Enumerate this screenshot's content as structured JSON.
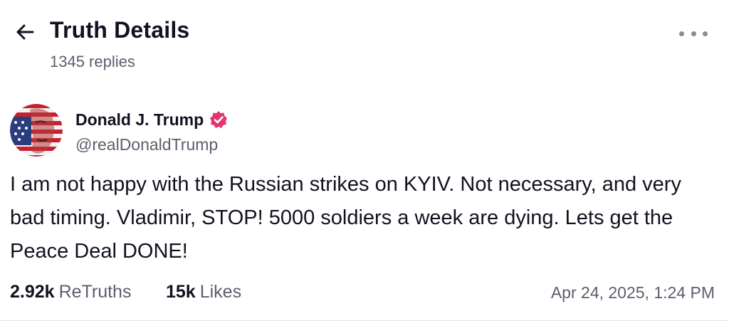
{
  "header": {
    "back_icon": "arrow-left-icon",
    "title": "Truth Details",
    "replies": "1345 replies",
    "more_icon": "more-horizontal-icon"
  },
  "post": {
    "author": {
      "name": "Donald J. Trump",
      "handle": "@realDonaldTrump",
      "verified_icon": "verified-badge-icon",
      "verified_color": "#e4356f"
    },
    "text": "I am not happy with the Russian strikes on KYIV. Not necessary, and very bad timing. Vladimir, STOP! 5000 soldiers a week are dying. Lets get the Peace Deal DONE!",
    "stats": {
      "retruths_count": "2.92k",
      "retruths_label": "ReTruths",
      "likes_count": "15k",
      "likes_label": "Likes"
    },
    "timestamp": "Apr 24, 2025, 1:24 PM"
  },
  "colors": {
    "text_primary": "#12111f",
    "text_secondary": "#5e5d6e",
    "background": "#ffffff"
  }
}
